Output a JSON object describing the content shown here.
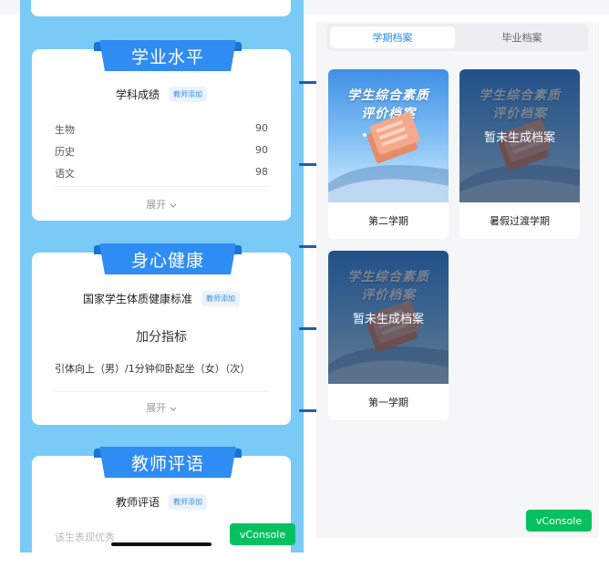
{
  "left": {
    "cards": [
      {
        "ribbon": "学业水平",
        "subtitle": "学科成绩",
        "tag": "教师添加",
        "rows": [
          {
            "subject": "生物",
            "score": "90"
          },
          {
            "subject": "历史",
            "score": "90"
          },
          {
            "subject": "语文",
            "score": "98"
          }
        ],
        "expand": "展开"
      },
      {
        "ribbon": "身心健康",
        "subtitle": "国家学生体质健康标准",
        "tag": "教师添加",
        "bonus_title": "加分指标",
        "bonus_item": "引体向上（男）/1分钟仰卧起坐（女）（次）",
        "expand": "展开"
      },
      {
        "ribbon": "教师评语",
        "subtitle": "教师评语",
        "tag": "教师添加",
        "comment": "该生表现优秀"
      }
    ],
    "vconsole": "vConsole"
  },
  "right": {
    "tabs": [
      {
        "label": "学期档案",
        "active": true
      },
      {
        "label": "毕业档案",
        "active": false
      }
    ],
    "cover_title_line1": "学生综合素质",
    "cover_title_line2": "评价档案",
    "semesters": [
      {
        "label": "第二学期",
        "status": ""
      },
      {
        "label": "暑假过渡学期",
        "status": "暂未生成档案"
      },
      {
        "label": "第一学期",
        "status": "暂未生成档案"
      }
    ],
    "vconsole": "vConsole"
  },
  "colors": {
    "left_bg": "#79caf7",
    "ribbon": "#2f8cf2",
    "accent": "#2b8cec",
    "vconsole": "#07c160"
  }
}
